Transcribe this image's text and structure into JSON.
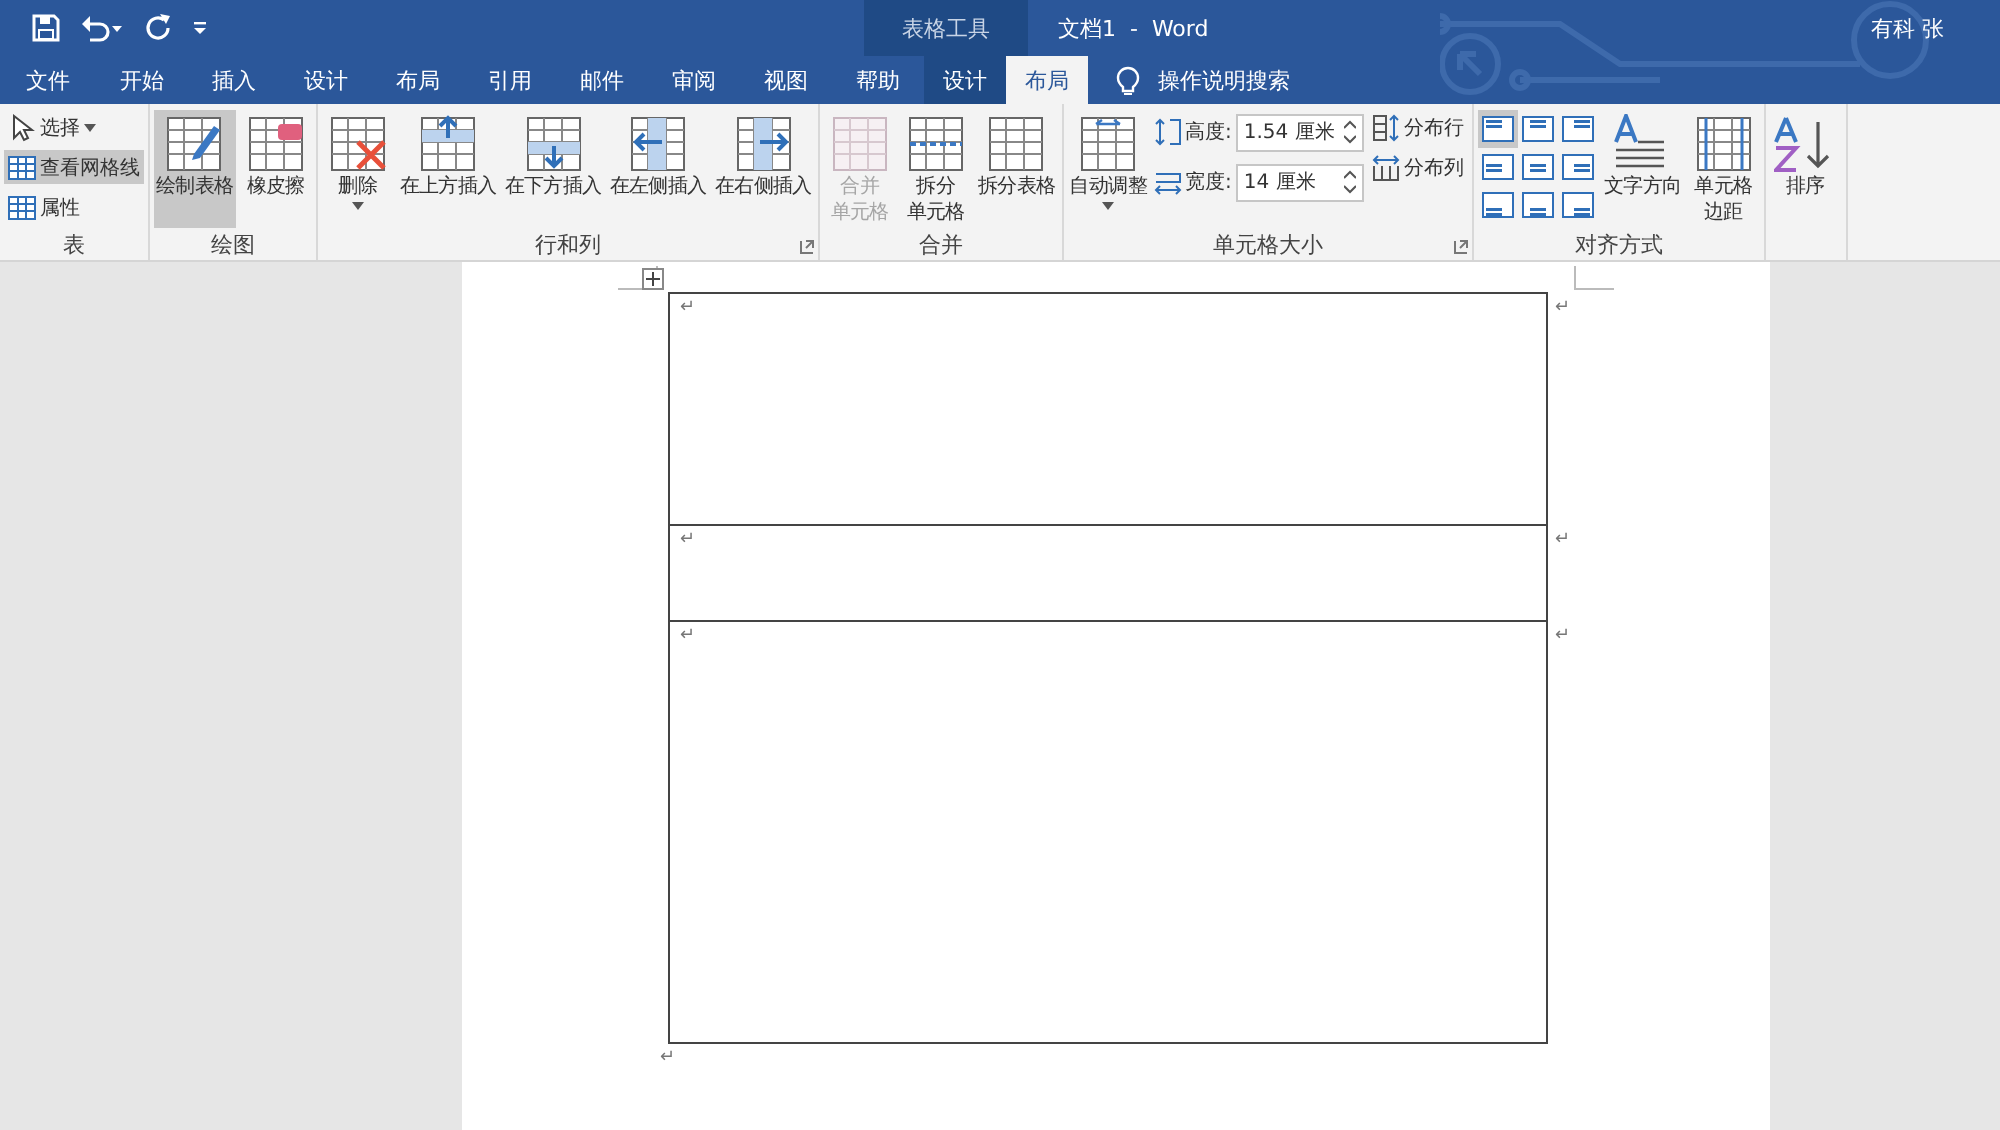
{
  "title_bar": {
    "context_group": "表格工具",
    "title": "文档1  -  Word",
    "user": "有科 张"
  },
  "tabs": [
    {
      "label": "文件",
      "selected": false,
      "kind": "main"
    },
    {
      "label": "开始",
      "selected": false,
      "kind": "main"
    },
    {
      "label": "插入",
      "selected": false,
      "kind": "main"
    },
    {
      "label": "设计",
      "selected": false,
      "kind": "main"
    },
    {
      "label": "布局",
      "selected": false,
      "kind": "main"
    },
    {
      "label": "引用",
      "selected": false,
      "kind": "main"
    },
    {
      "label": "邮件",
      "selected": false,
      "kind": "main"
    },
    {
      "label": "审阅",
      "selected": false,
      "kind": "main"
    },
    {
      "label": "视图",
      "selected": false,
      "kind": "main"
    },
    {
      "label": "帮助",
      "selected": false,
      "kind": "main"
    },
    {
      "label": "设计",
      "selected": false,
      "kind": "context"
    },
    {
      "label": "布局",
      "selected": true,
      "kind": "context"
    }
  ],
  "search": {
    "placeholder": "操作说明搜索"
  },
  "ribbon": [
    {
      "label": "表",
      "launcher": false,
      "items": [
        {
          "kind": "small",
          "label": "选择",
          "dropdown": true,
          "selected": false,
          "disabled": false
        },
        {
          "kind": "small",
          "label": "查看网格线",
          "dropdown": false,
          "selected": true,
          "disabled": false
        },
        {
          "kind": "small",
          "label": "属性",
          "dropdown": false,
          "selected": false,
          "disabled": false
        }
      ]
    },
    {
      "label": "绘图",
      "launcher": false,
      "items": [
        {
          "kind": "large",
          "label": "绘制表格",
          "dropdown": false,
          "selected": true,
          "disabled": false
        },
        {
          "kind": "large",
          "label": "橡皮擦",
          "dropdown": false,
          "selected": false,
          "disabled": false
        }
      ]
    },
    {
      "label": "行和列",
      "launcher": true,
      "items": [
        {
          "kind": "large",
          "label": "删除",
          "dropdown": true,
          "selected": false,
          "disabled": false
        },
        {
          "kind": "large",
          "label": "在上方插入",
          "dropdown": false,
          "selected": false,
          "disabled": false
        },
        {
          "kind": "large",
          "label": "在下方插入",
          "dropdown": false,
          "selected": false,
          "disabled": false
        },
        {
          "kind": "large",
          "label": "在左侧插入",
          "dropdown": false,
          "selected": false,
          "disabled": false
        },
        {
          "kind": "large",
          "label": "在右侧插入",
          "dropdown": false,
          "selected": false,
          "disabled": false
        }
      ]
    },
    {
      "label": "合并",
      "launcher": false,
      "items": [
        {
          "kind": "large",
          "label": "合并",
          "label_2": "单元格",
          "dropdown": false,
          "selected": false,
          "disabled": true
        },
        {
          "kind": "large",
          "label": "拆分",
          "label_2": "单元格",
          "dropdown": false,
          "selected": false,
          "disabled": false
        },
        {
          "kind": "large",
          "label": "拆分表格",
          "dropdown": false,
          "selected": false,
          "disabled": false
        }
      ]
    },
    {
      "label": "单元格大小",
      "launcher": true,
      "items": [
        {
          "kind": "large",
          "label": "自动调整",
          "dropdown": true,
          "selected": false,
          "disabled": false
        },
        {
          "kind": "spin",
          "label": "高度:",
          "value": "1.54 厘米"
        },
        {
          "kind": "spin",
          "label": "宽度:",
          "value": "14 厘米"
        },
        {
          "kind": "small",
          "label": "分布行",
          "dropdown": false,
          "selected": false,
          "disabled": false
        },
        {
          "kind": "small",
          "label": "分布列",
          "dropdown": false,
          "selected": false,
          "disabled": false
        }
      ]
    },
    {
      "label": "对齐方式",
      "launcher": false,
      "items": [
        {
          "kind": "align",
          "selected": true
        },
        {
          "kind": "align",
          "selected": false
        },
        {
          "kind": "align",
          "selected": false
        },
        {
          "kind": "align",
          "selected": false
        },
        {
          "kind": "align",
          "selected": false
        },
        {
          "kind": "align",
          "selected": false
        },
        {
          "kind": "align",
          "selected": false
        },
        {
          "kind": "align",
          "selected": false
        },
        {
          "kind": "align",
          "selected": false
        },
        {
          "kind": "large",
          "label": "文字方向",
          "dropdown": false,
          "selected": false,
          "disabled": false
        },
        {
          "kind": "large",
          "label": "单元格",
          "label_2": "边距",
          "dropdown": false,
          "selected": false,
          "disabled": false
        }
      ]
    },
    {
      "launcher": false,
      "items": [
        {
          "kind": "large",
          "label": "排序",
          "dropdown": false,
          "selected": false,
          "disabled": false
        }
      ]
    }
  ],
  "document": {
    "table": {
      "rows": [
        {
          "cell_mark": "↵",
          "end_mark": "↵"
        },
        {
          "cell_mark": "↵",
          "end_mark": "↵"
        },
        {
          "cell_mark": "↵",
          "end_mark": "↵"
        }
      ]
    },
    "after_mark": "↵"
  }
}
